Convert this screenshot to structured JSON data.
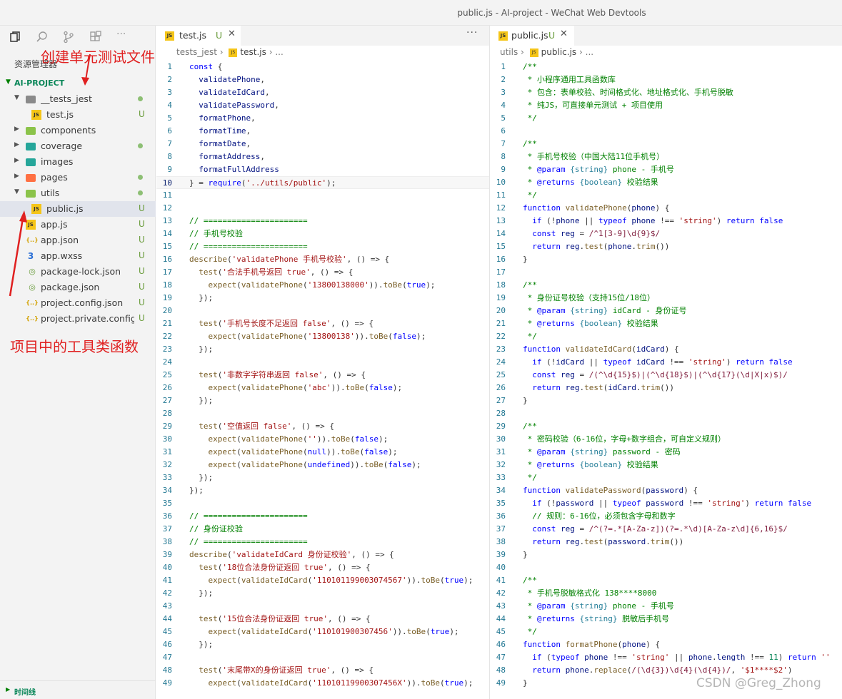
{
  "window": {
    "title": "public.js - AI-project - WeChat Web Devtools"
  },
  "sidebar": {
    "explorer_title": "资源管理器",
    "project": "AI-PROJECT",
    "timeline": "时间线",
    "items": [
      {
        "label": "__tests_jest",
        "type": "folder",
        "status": "dot"
      },
      {
        "label": "test.js",
        "type": "js",
        "status": "U"
      },
      {
        "label": "components",
        "type": "folder",
        "status": ""
      },
      {
        "label": "coverage",
        "type": "folder",
        "status": "dot"
      },
      {
        "label": "images",
        "type": "folder",
        "status": ""
      },
      {
        "label": "pages",
        "type": "folder",
        "status": "dot"
      },
      {
        "label": "utils",
        "type": "folder",
        "status": "dot"
      },
      {
        "label": "public.js",
        "type": "js",
        "status": "U"
      },
      {
        "label": "app.js",
        "type": "js",
        "status": "U"
      },
      {
        "label": "app.json",
        "type": "json",
        "status": "U"
      },
      {
        "label": "app.wxss",
        "type": "css",
        "status": "U"
      },
      {
        "label": "package-lock.json",
        "type": "json",
        "status": "U"
      },
      {
        "label": "package.json",
        "type": "json",
        "status": "U"
      },
      {
        "label": "project.config.json",
        "type": "json",
        "status": "U"
      },
      {
        "label": "project.private.config...",
        "type": "json",
        "status": "U"
      }
    ]
  },
  "annotations": {
    "top": "创建单元测试文件",
    "bottom": "项目中的工具类函数"
  },
  "left_editor": {
    "tab": "test.js",
    "tab_status": "U",
    "more": "···",
    "crumb": [
      "tests_jest",
      "test.js",
      "..."
    ],
    "lines": [
      "const {",
      "  validatePhone,",
      "  validateIdCard,",
      "  validatePassword,",
      "  formatPhone,",
      "  formatTime,",
      "  formatDate,",
      "  formatAddress,",
      "  formatFullAddress",
      "} = require('../utils/public');",
      "",
      "",
      "// ======================",
      "// 手机号校验",
      "// ======================",
      "describe('validatePhone 手机号校验', () => {",
      "  test('合法手机号返回 true', () => {",
      "    expect(validatePhone('13800138000')).toBe(true);",
      "  });",
      "",
      "  test('手机号长度不足返回 false', () => {",
      "    expect(validatePhone('13800138')).toBe(false);",
      "  });",
      "",
      "  test('非数字字符串返回 false', () => {",
      "    expect(validatePhone('abc')).toBe(false);",
      "  });",
      "",
      "  test('空值返回 false', () => {",
      "    expect(validatePhone('')).toBe(false);",
      "    expect(validatePhone(null)).toBe(false);",
      "    expect(validatePhone(undefined)).toBe(false);",
      "  });",
      "});",
      "",
      "// ======================",
      "// 身份证校验",
      "// ======================",
      "describe('validateIdCard 身份证校验', () => {",
      "  test('18位合法身份证返回 true', () => {",
      "    expect(validateIdCard('110101199003074567')).toBe(true);",
      "  });",
      "",
      "  test('15位合法身份证返回 true', () => {",
      "    expect(validateIdCard('110101900307456')).toBe(true);",
      "  });",
      "",
      "  test('末尾带X的身份证返回 true', () => {",
      "    expect(validateIdCard('11010119900307456X')).toBe(true);"
    ]
  },
  "right_editor": {
    "tab": "public.js",
    "tab_status": "U",
    "crumb": [
      "utils",
      "public.js",
      "..."
    ],
    "lines": [
      "/**",
      " * 小程序通用工具函数库",
      " * 包含：表单校验、时间格式化、地址格式化、手机号脱敏",
      " * 纯JS，可直接单元测试 + 项目使用",
      " */",
      "",
      "/**",
      " * 手机号校验（中国大陆11位手机号）",
      " * @param {string} phone - 手机号",
      " * @returns {boolean} 校验结果",
      " */",
      "function validatePhone(phone) {",
      "  if (!phone || typeof phone !== 'string') return false",
      "  const reg = /^1[3-9]\\d{9}$/",
      "  return reg.test(phone.trim())",
      "}",
      "",
      "/**",
      " * 身份证号校验（支持15位/18位）",
      " * @param {string} idCard - 身份证号",
      " * @returns {boolean} 校验结果",
      " */",
      "function validateIdCard(idCard) {",
      "  if (!idCard || typeof idCard !== 'string') return false",
      "  const reg = /(^\\d{15}$)|(^\\d{18}$)|(^\\d{17}(\\d|X|x)$)/",
      "  return reg.test(idCard.trim())",
      "}",
      "",
      "/**",
      " * 密码校验（6-16位，字母+数字组合，可自定义规则）",
      " * @param {string} password - 密码",
      " * @returns {boolean} 校验结果",
      " */",
      "function validatePassword(password) {",
      "  if (!password || typeof password !== 'string') return false",
      "  // 规则：6-16位，必须包含字母和数字",
      "  const reg = /^(?=.*[A-Za-z])(?=.*\\d)[A-Za-z\\d]{6,16}$/",
      "  return reg.test(password.trim())",
      "}",
      "",
      "/**",
      " * 手机号脱敏格式化 138****8000",
      " * @param {string} phone - 手机号",
      " * @returns {string} 脱敏后手机号",
      " */",
      "function formatPhone(phone) {",
      "  if (typeof phone !== 'string' || phone.length !== 11) return ''",
      "  return phone.replace(/(\\d{3})\\d{4}(\\d{4})/, '$1****$2')",
      "}"
    ]
  },
  "watermark": "CSDN @Greg_Zhong"
}
